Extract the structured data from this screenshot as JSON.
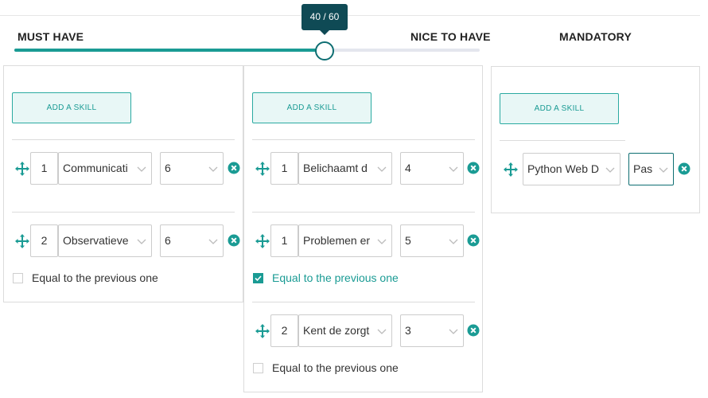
{
  "slider": {
    "left_label": "MUST HAVE",
    "right_label": "NICE TO HAVE",
    "tooltip": "40 / 60",
    "value": 40,
    "max": 60,
    "fill_color": "#1a9b94"
  },
  "mandatory": {
    "title": "MANDATORY",
    "add_label": "ADD A SKILL",
    "skills": [
      {
        "name": "Python Web D",
        "level": "Pas"
      }
    ]
  },
  "must_have": {
    "add_label": "ADD A SKILL",
    "skills": [
      {
        "rank": "1",
        "name": "Communicati",
        "level": "6"
      },
      {
        "rank": "2",
        "name": "Observatieve",
        "level": "6"
      }
    ],
    "equal_label": "Equal to the previous one",
    "equal_checked": false
  },
  "nice_to_have": {
    "add_label": "ADD A SKILL",
    "skills": [
      {
        "rank": "1",
        "name": "Belichaamt d",
        "level": "4"
      },
      {
        "rank": "1",
        "name": "Problemen er",
        "level": "5"
      },
      {
        "rank": "2",
        "name": "Kent de zorgt",
        "level": "3"
      }
    ],
    "equal_label_1": "Equal to the previous one",
    "equal_checked_1": true,
    "equal_label_2": "Equal to the previous one",
    "equal_checked_2": false
  },
  "icons": {
    "move": "move-arrows-icon",
    "remove": "remove-circle-icon",
    "chevron": "chevron-down-icon",
    "check": "checkmark-icon"
  },
  "colors": {
    "accent": "#1a9b94",
    "tooltip_bg": "#0f4a55",
    "button_bg": "#e8f7f6"
  }
}
